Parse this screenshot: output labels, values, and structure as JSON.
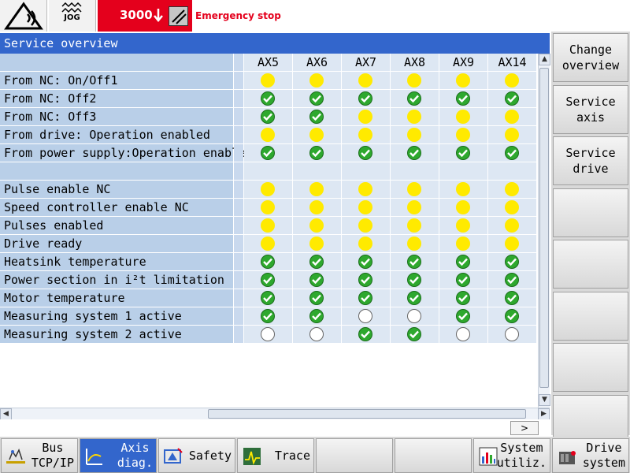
{
  "header": {
    "mode_label": "JOG",
    "alarm_number": "3000",
    "alarm_text": "Emergency stop"
  },
  "title": "Service overview",
  "table": {
    "axes": [
      "AX5",
      "AX6",
      "AX7",
      "AX8",
      "AX9",
      "AX14"
    ],
    "rows": [
      {
        "label": "From NC: On/Off1",
        "states": [
          "yellow",
          "yellow",
          "yellow",
          "yellow",
          "yellow",
          "yellow"
        ]
      },
      {
        "label": "From NC: Off2",
        "states": [
          "green",
          "green",
          "green",
          "green",
          "green",
          "green"
        ]
      },
      {
        "label": "From NC: Off3",
        "states": [
          "green",
          "green",
          "yellow",
          "yellow",
          "yellow",
          "yellow"
        ]
      },
      {
        "label": "From drive: Operation enabled",
        "states": [
          "yellow",
          "yellow",
          "yellow",
          "yellow",
          "yellow",
          "yellow"
        ]
      },
      {
        "label": "From power supply:Operation enabled",
        "states": [
          "green",
          "green",
          "green",
          "green",
          "green",
          "green"
        ]
      },
      {
        "label": "",
        "states": [
          "",
          "",
          "",
          "",
          "",
          ""
        ]
      },
      {
        "label": "Pulse enable NC",
        "states": [
          "yellow",
          "yellow",
          "yellow",
          "yellow",
          "yellow",
          "yellow"
        ]
      },
      {
        "label": "Speed controller enable NC",
        "states": [
          "yellow",
          "yellow",
          "yellow",
          "yellow",
          "yellow",
          "yellow"
        ]
      },
      {
        "label": "Pulses enabled",
        "states": [
          "yellow",
          "yellow",
          "yellow",
          "yellow",
          "yellow",
          "yellow"
        ]
      },
      {
        "label": "Drive ready",
        "states": [
          "yellow",
          "yellow",
          "yellow",
          "yellow",
          "yellow",
          "yellow"
        ]
      },
      {
        "label": "Heatsink temperature",
        "states": [
          "green",
          "green",
          "green",
          "green",
          "green",
          "green"
        ]
      },
      {
        "label": "Power section in i²t limitation",
        "states": [
          "green",
          "green",
          "green",
          "green",
          "green",
          "green"
        ]
      },
      {
        "label": "Motor temperature",
        "states": [
          "green",
          "green",
          "green",
          "green",
          "green",
          "green"
        ]
      },
      {
        "label": "Measuring system 1 active",
        "states": [
          "green",
          "green",
          "empty",
          "empty",
          "green",
          "green"
        ]
      },
      {
        "label": "Measuring system 2 active",
        "states": [
          "empty",
          "empty",
          "green",
          "green",
          "empty",
          "empty"
        ]
      }
    ]
  },
  "softkeys_vertical": [
    {
      "label": "Change\noverview"
    },
    {
      "label": "Service\naxis"
    },
    {
      "label": "Service\ndrive"
    },
    {
      "label": ""
    },
    {
      "label": ""
    },
    {
      "label": ""
    },
    {
      "label": ""
    },
    {
      "label": ""
    }
  ],
  "softkeys_horizontal": [
    {
      "label": "Bus\nTCP/IP",
      "icon": "bus-icon",
      "active": false
    },
    {
      "label": "Axis\ndiag.",
      "icon": "axis-diag-icon",
      "active": true
    },
    {
      "label": "Safety",
      "icon": "safety-icon",
      "active": false
    },
    {
      "label": "Trace",
      "icon": "trace-icon",
      "active": false
    },
    {
      "label": "",
      "icon": "",
      "active": false
    },
    {
      "label": "",
      "icon": "",
      "active": false
    },
    {
      "label": "System\nutiliz.",
      "icon": "system-utilization-icon",
      "active": false
    },
    {
      "label": "Drive\nsystem",
      "icon": "drive-system-icon",
      "active": false
    }
  ],
  "pager": {
    "next_label": ">"
  },
  "colors": {
    "title_bar": "#3366cc",
    "label_bg": "#b9cfe8",
    "cell_bg": "#dde7f3",
    "status_yellow": "#ffea00",
    "status_green": "#2ea82e",
    "alarm_red": "#e4001c"
  }
}
